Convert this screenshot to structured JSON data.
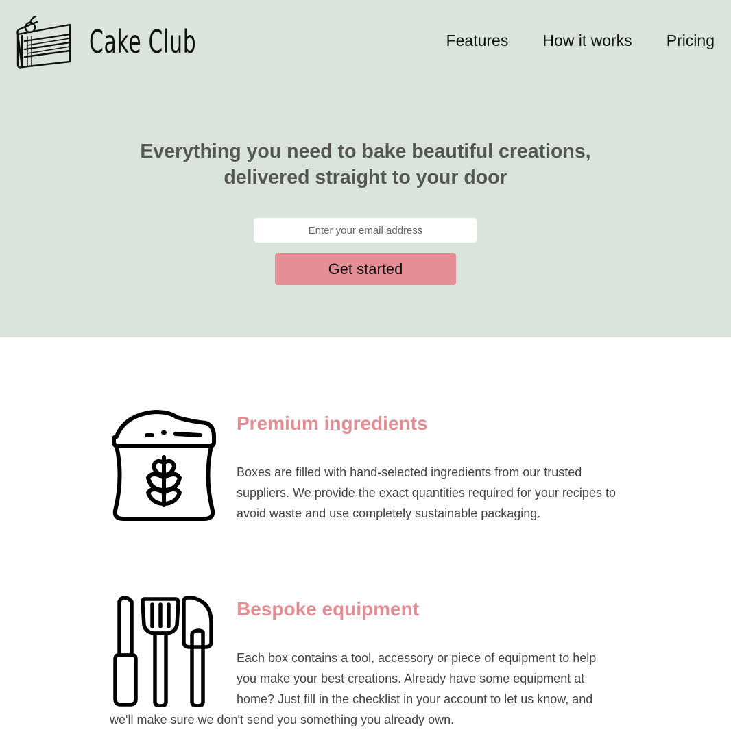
{
  "header": {
    "brand": "Cake Club",
    "nav": [
      {
        "label": "Features"
      },
      {
        "label": "How it works"
      },
      {
        "label": "Pricing"
      }
    ]
  },
  "hero": {
    "headline": "Everything you need to bake beautiful creations, delivered straight to your door",
    "email_placeholder": "Enter your email address",
    "cta_label": "Get started"
  },
  "features": [
    {
      "icon": "flour-sack-icon",
      "title": "Premium ingredients",
      "body": "Boxes are filled with hand-selected ingredients from our trusted suppliers. We provide the exact quantities required for your recipes to avoid waste and use completely sustainable packaging."
    },
    {
      "icon": "baking-utensils-icon",
      "title": "Bespoke equipment",
      "body_lines": [
        "Each box contains a tool, accessory or piece of equipment to help",
        "you make your best creations. Already have some equipment at",
        "home? Just fill in the checklist in your account to let us know, and",
        "we'll make sure we don't send you something you already own."
      ]
    }
  ],
  "colors": {
    "hero_bg": "#dae4dc",
    "accent": "#e48d94",
    "text": "#444444"
  }
}
